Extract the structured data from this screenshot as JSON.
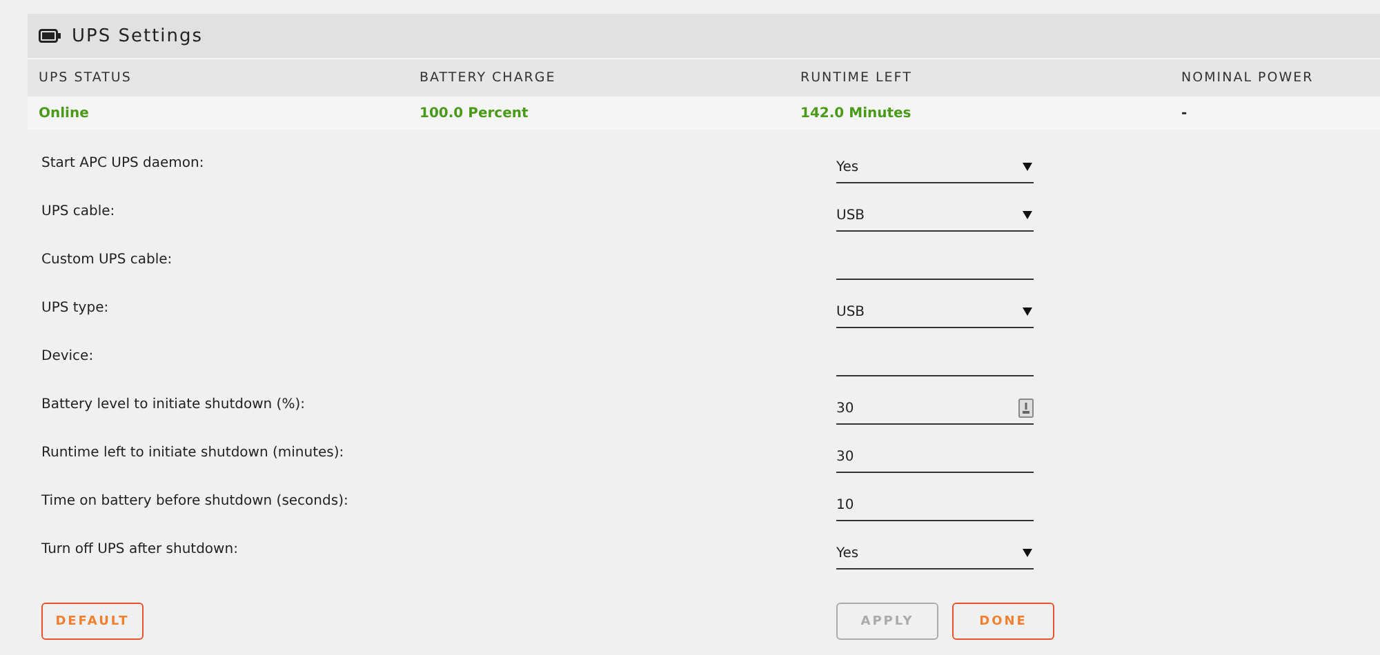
{
  "panel": {
    "title": "UPS Settings"
  },
  "status_table": {
    "columns": [
      "UPS STATUS",
      "BATTERY CHARGE",
      "RUNTIME LEFT",
      "NOMINAL POWER"
    ],
    "row": [
      {
        "value": "Online",
        "color": "#4a9a1a"
      },
      {
        "value": "100.0 Percent",
        "color": "#4a9a1a"
      },
      {
        "value": "142.0 Minutes",
        "color": "#4a9a1a"
      },
      {
        "value": "-",
        "color": "#222222"
      }
    ]
  },
  "settings": [
    {
      "label": "Start APC UPS daemon:",
      "kind": "select",
      "value": "Yes"
    },
    {
      "label": "UPS cable:",
      "kind": "select",
      "value": "USB"
    },
    {
      "label": "Custom UPS cable:",
      "kind": "text"
    },
    {
      "label": "UPS type:",
      "kind": "select",
      "value": "USB"
    },
    {
      "label": "Device:",
      "kind": "text"
    },
    {
      "label": "Battery level to initiate shutdown (%):",
      "kind": "number",
      "value": "30"
    },
    {
      "label": "Runtime left to initiate shutdown (minutes):",
      "kind": "text",
      "value": "30"
    },
    {
      "label": "Time on battery before shutdown (seconds):",
      "kind": "text",
      "value": "10"
    },
    {
      "label": "Turn off UPS after shutdown:",
      "kind": "select",
      "value": "Yes"
    }
  ],
  "buttons": {
    "left": [
      {
        "label": "DEFAULT",
        "disabled": false
      }
    ],
    "right": [
      {
        "label": "APPLY",
        "disabled": true
      },
      {
        "label": "DONE",
        "disabled": false
      }
    ]
  }
}
